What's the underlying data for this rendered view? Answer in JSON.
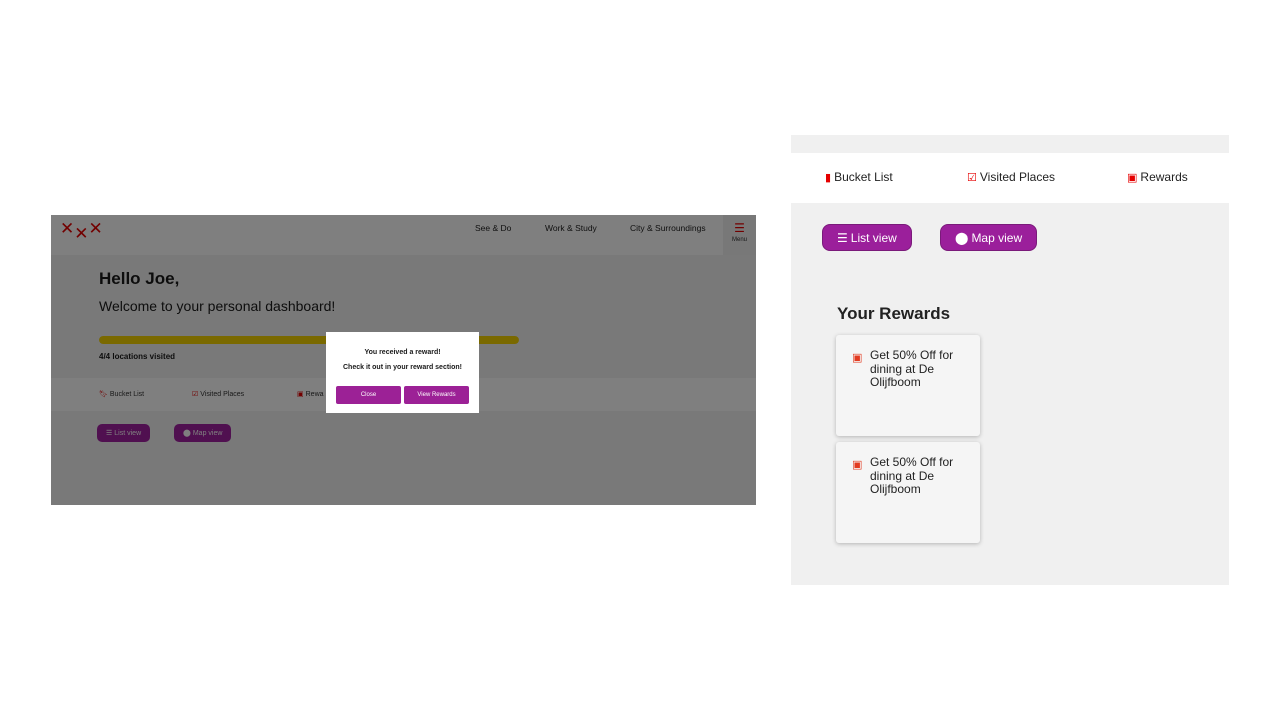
{
  "left": {
    "logo": [
      "✕",
      "✕",
      "✕"
    ],
    "nav": [
      "See & Do",
      "Work & Study",
      "City & Surroundings"
    ],
    "menu": {
      "icon": "hamburger-icon",
      "label": "Menu"
    },
    "greeting": "Hello Joe,",
    "welcome": "Welcome to your personal dashboard!",
    "progress": {
      "fraction": 1.0,
      "label": "4/4 locations visited"
    },
    "tabs": [
      "Bucket List",
      "Visited Places",
      "Rewa"
    ],
    "views": [
      "List view",
      "Map view"
    ],
    "modal": {
      "title": "You received a reward!",
      "message": "Check it out in your reward section!",
      "close": "Close",
      "view_rewards": "View Rewards"
    }
  },
  "right": {
    "tabs": [
      {
        "label": "Bucket List",
        "icon": "bookmark-icon"
      },
      {
        "label": "Visited Places",
        "icon": "checkbox-icon"
      },
      {
        "label": "Rewards",
        "icon": "gift-icon"
      }
    ],
    "views": [
      {
        "label": "List view",
        "icon": "list-icon"
      },
      {
        "label": "Map view",
        "icon": "map-marker-icon"
      }
    ],
    "heading": "Your Rewards",
    "rewards": [
      {
        "text": "Get 50% Off for dining at De Olijfboom"
      },
      {
        "text": "Get 50% Off for dining at De Olijfboom"
      }
    ]
  },
  "colors": {
    "brand_red": "#e50000",
    "accent_purple": "#9b1f9b",
    "progress_yellow": "#f5d300"
  }
}
